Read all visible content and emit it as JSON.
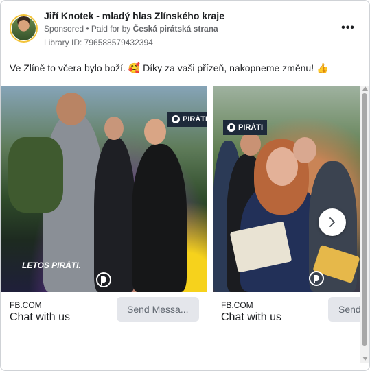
{
  "header": {
    "page_name": "Jiří Knotek - mladý hlas Zlínského kraje",
    "sponsored_label": "Sponsored",
    "separator": " • ",
    "paid_for_prefix": "Paid for by ",
    "paid_for_by": "Česká pirátská strana",
    "library_id": "Library ID: 796588579432394",
    "more_label": "•••"
  },
  "ad_text": "Ve Zlíně to včera bylo boží. 🥰 Díky za vaši přízeň, nakopneme změnu! 👍",
  "carousel": {
    "cards": [
      {
        "banner": "PIRÁTI",
        "slogan": "LETOS PIRÁTI.",
        "domain": "FB.COM",
        "cta_title": "Chat with us",
        "cta_button": "Send Messa..."
      },
      {
        "banner": "PIRÁTI",
        "domain": "FB.COM",
        "cta_title": "Chat with us",
        "cta_button": "Send Message"
      }
    ],
    "next_icon": "chevron-right-icon"
  },
  "colors": {
    "accent_yellow": "#f6d21c",
    "accent_purple": "#8a3fb8",
    "button_gray": "#e4e6eb",
    "secondary_text": "#65676b"
  }
}
